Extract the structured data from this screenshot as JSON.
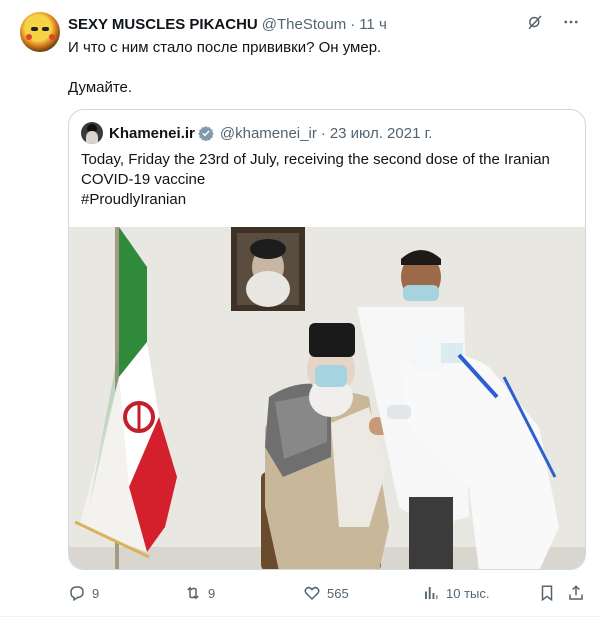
{
  "tweet": {
    "display_name": "SEXY MUSCLES PIKACHU",
    "handle": "@TheStoum",
    "dot": "·",
    "time": "11 ч",
    "text_line1": "И что с ним стало после прививки? Он умер.",
    "text_line2": "Думайте.",
    "avatar_icon": "pikachu-avatar-icon",
    "header_icons": [
      "grok-icon",
      "more-icon"
    ]
  },
  "quote": {
    "display_name": "Khamenei.ir",
    "handle": "@khamenei_ir",
    "dot": "·",
    "date": "23 июл. 2021 г.",
    "text": [
      "Today, Friday the 23rd of July, receiving the second dose of the Iranian",
      "COVID-19 vaccine",
      "#ProudlyIranian"
    ],
    "verified_color": "#829aab"
  },
  "actions": {
    "replies": "9",
    "retweets": "9",
    "likes": "565",
    "views": "10 тыс.",
    "icons": [
      "reply-icon",
      "retweet-icon",
      "like-icon",
      "views-icon",
      "bookmark-icon",
      "share-icon"
    ]
  },
  "colors": {
    "text": "#0f1419",
    "secondary": "#536471",
    "border": "#cfd9de",
    "retweet_icon": "#536471"
  }
}
